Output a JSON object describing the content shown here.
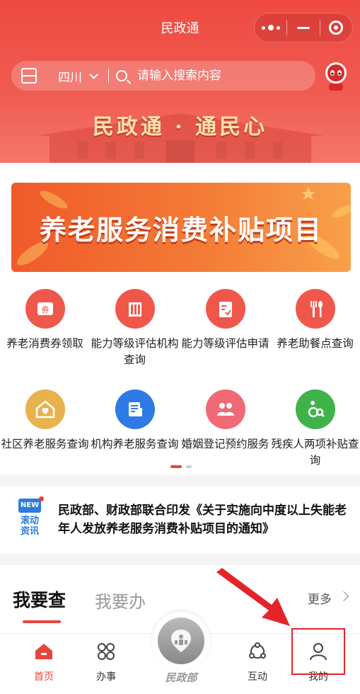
{
  "header": {
    "title": "民政通",
    "region": "四川",
    "search_placeholder": "请输入搜索内容",
    "slogan": "民政通 · 通民心"
  },
  "banner": {
    "text": "养老服务消费补贴项目"
  },
  "services": [
    {
      "label": "养老消费券领取",
      "icon": "ticket-icon",
      "color": "#f0574b"
    },
    {
      "label": "能力等级评估机构查询",
      "icon": "building-icon",
      "color": "#f0574b"
    },
    {
      "label": "能力等级评估申请",
      "icon": "clipboard-check-icon",
      "color": "#f0574b"
    },
    {
      "label": "养老助餐点查询",
      "icon": "fork-spoon-icon",
      "color": "#f0574b"
    },
    {
      "label": "社区养老服务查询",
      "icon": "home-heart-icon",
      "color": "#e8b24e"
    },
    {
      "label": "机构养老服务查询",
      "icon": "document-icon",
      "color": "#2f7be6"
    },
    {
      "label": "婚姻登记预约服务",
      "icon": "couple-icon",
      "color": "#f06a76"
    },
    {
      "label": "残疾人两项补贴查询",
      "icon": "wheelchair-search-icon",
      "color": "#3fb24a"
    }
  ],
  "news": {
    "tag": "NEW",
    "kind": "滚动资讯",
    "text": "民政部、财政部联合印发《关于实施向中度以上失能老年人发放养老服务消费补贴项目的通知》"
  },
  "section": {
    "tab_active": "我要查",
    "tab_inactive": "我要办",
    "more": "更多"
  },
  "tabbar": {
    "home": "首页",
    "affairs": "办事",
    "center": "民政部",
    "interact": "互动",
    "mine": "我的"
  },
  "colors": {
    "brand": "#e8463d",
    "highlight": "#e5232a"
  }
}
